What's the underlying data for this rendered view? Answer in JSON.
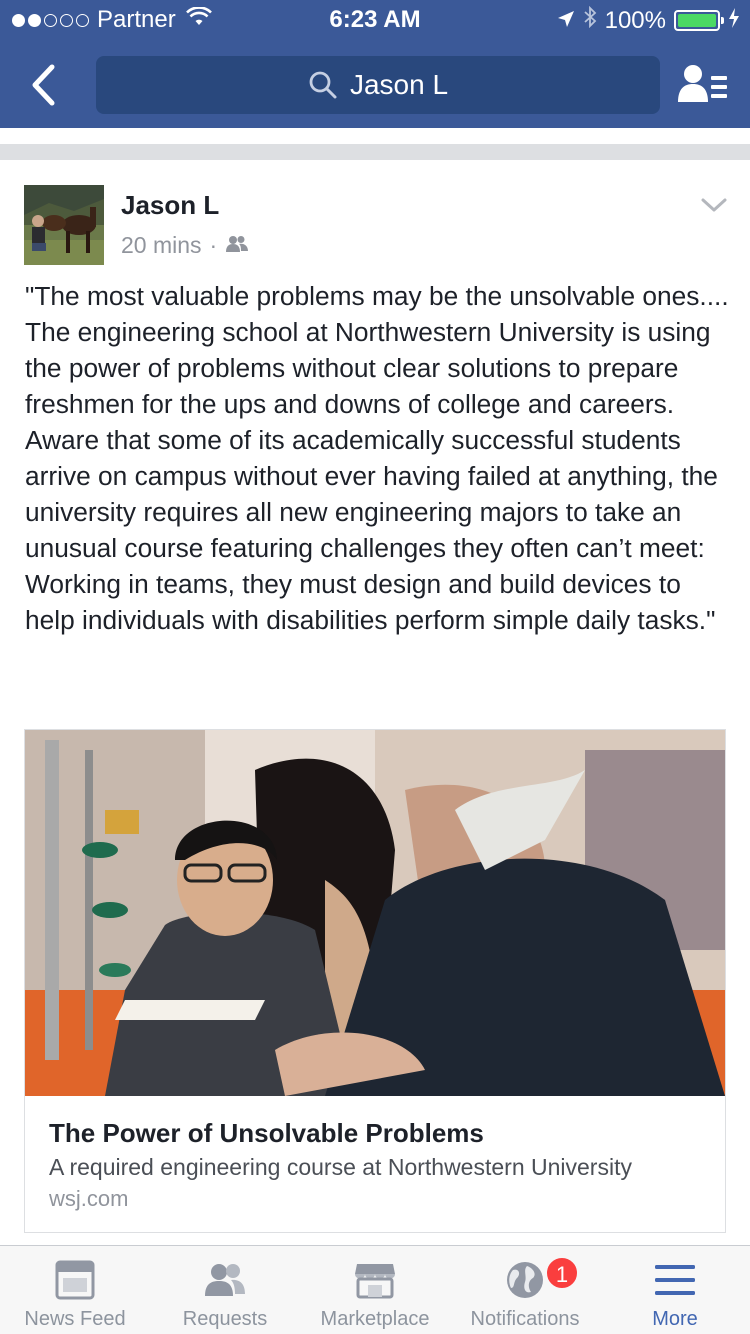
{
  "status_bar": {
    "carrier": "Partner",
    "time": "6:23 AM",
    "battery": "100%",
    "signal_dots_filled": 2,
    "signal_dots_total": 5
  },
  "nav": {
    "search_text": "Jason L",
    "icons": [
      "back-chevron-icon",
      "search-icon",
      "profile-list-icon"
    ]
  },
  "post": {
    "author": "Jason L",
    "time": "20 mins",
    "separator": "·",
    "audience_icon": "friends-icon",
    "text": "\"The most valuable problems may be the unsolvable ones.... The engineering school at Northwestern University is using the power of problems without clear solutions to prepare freshmen for the ups and downs of college and careers. Aware that some of its academically successful students arrive on campus without ever having failed at anything, the university requires all new engineering majors to take an unusual course featuring challenges they often can’t meet: Working in teams, they must design and build devices to help individuals with disabilities perform simple daily tasks.\"",
    "link": {
      "title": "The Power of Unsolvable Problems",
      "description": "A required engineering course at Northwestern University",
      "domain": "wsj.com"
    }
  },
  "tabbar": {
    "tabs": [
      {
        "label": "News Feed",
        "icon": "news-feed-icon"
      },
      {
        "label": "Requests",
        "icon": "friend-requests-icon"
      },
      {
        "label": "Marketplace",
        "icon": "marketplace-icon"
      },
      {
        "label": "Notifications",
        "icon": "globe-icon"
      },
      {
        "label": "More",
        "icon": "menu-icon"
      }
    ],
    "notifications_badge": "1",
    "active_tab": "More"
  },
  "colors": {
    "brand_blue": "#3b5998",
    "search_bg": "#29487d",
    "active_tab": "#4267b2",
    "badge_red": "#fa3e3e",
    "battery_green": "#4cd964"
  }
}
